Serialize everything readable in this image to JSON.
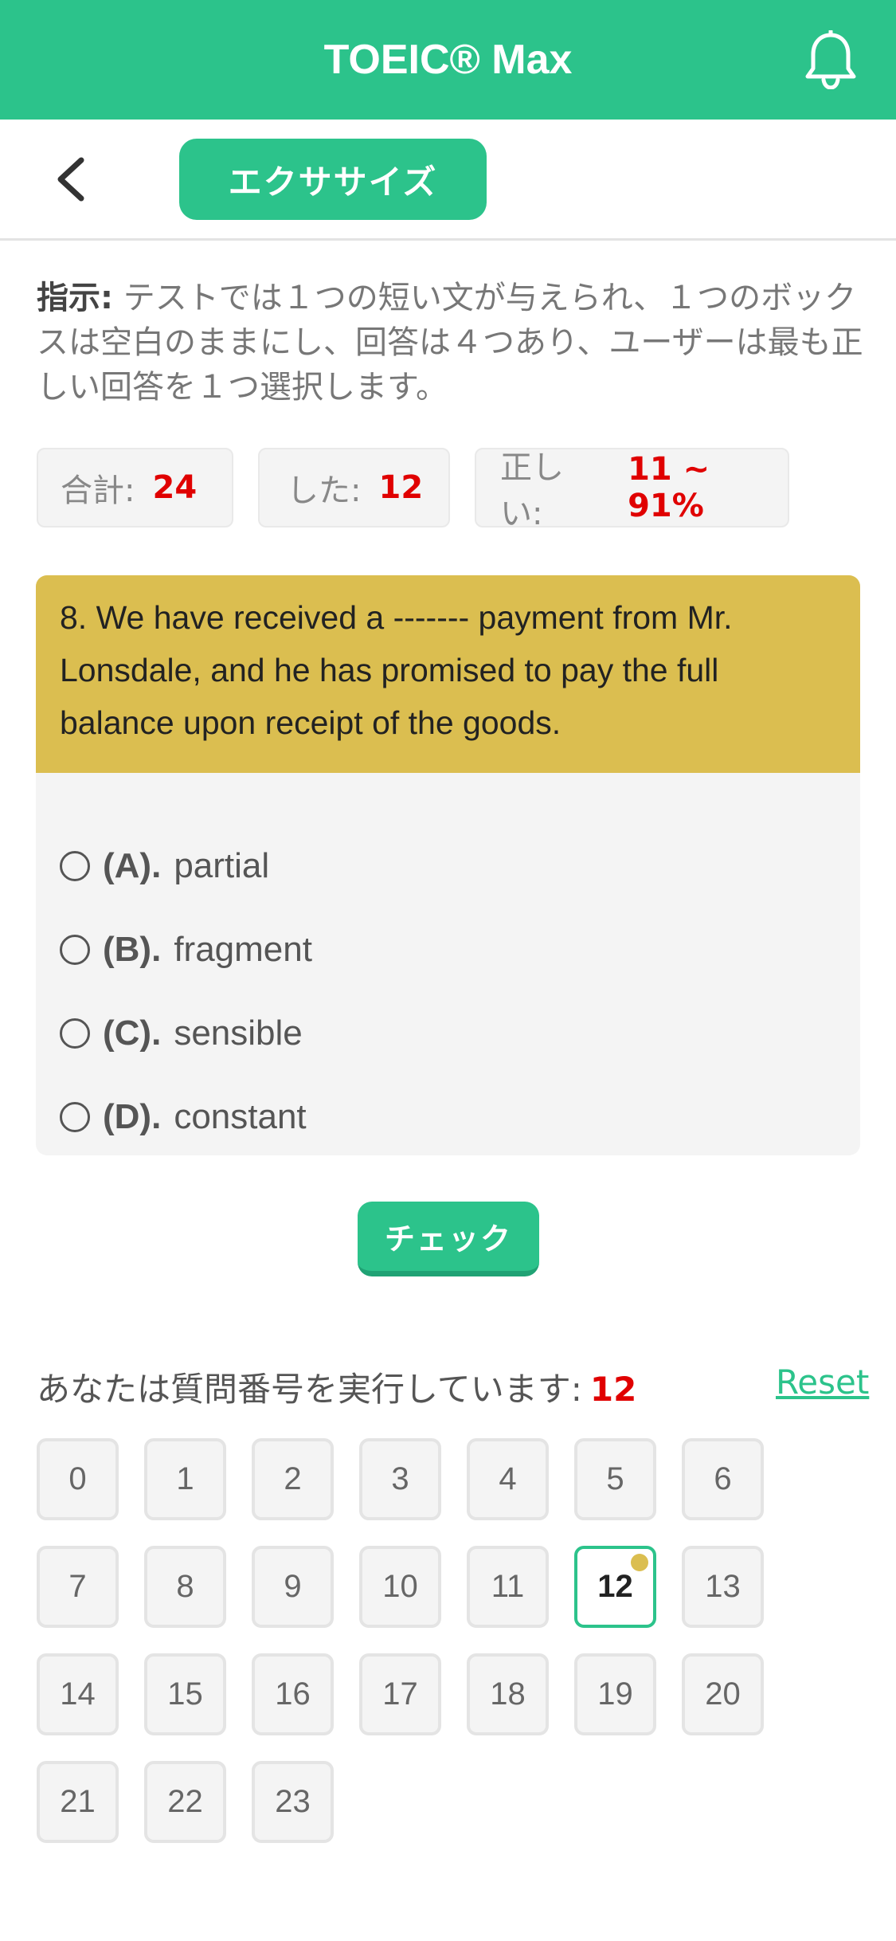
{
  "header": {
    "title": "TOEIC® Max",
    "bell_icon": "bell-icon"
  },
  "subbar": {
    "back_icon": "chevron-left-icon",
    "exercise_label": "エクササイズ"
  },
  "instructions": {
    "label": "指示:",
    "text": " テストでは１つの短い文が与えられ、１つのボックスは空白のままにし、回答は４つあり、ユーザーは最も正しい回答を１つ選択します。"
  },
  "stats": {
    "total_label": "合計:",
    "total_value": "24",
    "done_label": "した:",
    "done_value": "12",
    "correct_label": "正しい:",
    "correct_value": "11 ~ 91%"
  },
  "question": {
    "text": "8. We have received a ------- payment from Mr. Lonsdale, and he has promised to pay the full balance upon receipt of the goods.",
    "options": [
      {
        "letter": "(A).",
        "text": "partial"
      },
      {
        "letter": "(B).",
        "text": "fragment"
      },
      {
        "letter": "(C).",
        "text": "sensible"
      },
      {
        "letter": "(D).",
        "text": "constant"
      }
    ]
  },
  "check_label": "チェック",
  "progress": {
    "label": "あなたは質問番号を実行しています:",
    "current": "12",
    "reset_label": "Reset"
  },
  "question_numbers": [
    "0",
    "1",
    "2",
    "3",
    "4",
    "5",
    "6",
    "7",
    "8",
    "9",
    "10",
    "11",
    "12",
    "13",
    "14",
    "15",
    "16",
    "17",
    "18",
    "19",
    "20",
    "21",
    "22",
    "23"
  ],
  "colors": {
    "primary": "#2cc38b",
    "question_bg": "#dbbe50",
    "accent_red": "#e00000"
  }
}
